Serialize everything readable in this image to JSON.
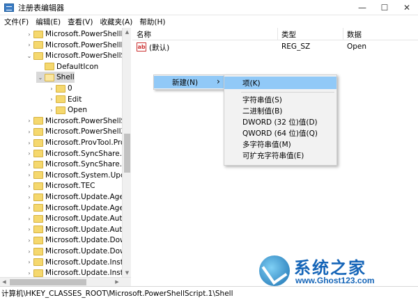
{
  "window": {
    "title": "注册表编辑器",
    "minimize": "—",
    "maximize": "☐",
    "close": "✕"
  },
  "menu": [
    "文件(F)",
    "编辑(E)",
    "查看(V)",
    "收藏夹(A)",
    "帮助(H)"
  ],
  "tree": [
    {
      "label": "Microsoft.PowerShellDa",
      "arrow": "›",
      "selected": false
    },
    {
      "label": "Microsoft.PowerShellMc",
      "arrow": "›",
      "selected": false
    },
    {
      "label": "Microsoft.PowerShellScr",
      "arrow": "⌄",
      "selected": false
    },
    {
      "label": "DefaultIcon",
      "arrow": "",
      "selected": false
    },
    {
      "label": "Shell",
      "arrow": "⌄",
      "selected": true
    },
    {
      "label": "0",
      "arrow": "›",
      "selected": false
    },
    {
      "label": "Edit",
      "arrow": "›",
      "selected": false
    },
    {
      "label": "Open",
      "arrow": "›",
      "selected": false
    },
    {
      "label": "Microsoft.PowerShellSes",
      "arrow": "›",
      "selected": false
    },
    {
      "label": "Microsoft.PowerShellXM",
      "arrow": "›",
      "selected": false
    },
    {
      "label": "Microsoft.ProvTool.Prov",
      "arrow": "›",
      "selected": false
    },
    {
      "label": "Microsoft.SyncShare.Syr",
      "arrow": "›",
      "selected": false
    },
    {
      "label": "Microsoft.SyncShare.Syr",
      "arrow": "›",
      "selected": false
    },
    {
      "label": "Microsoft.System.Updat",
      "arrow": "›",
      "selected": false
    },
    {
      "label": "Microsoft.TEC",
      "arrow": "›",
      "selected": false
    },
    {
      "label": "Microsoft.Update.Agent",
      "arrow": "›",
      "selected": false
    },
    {
      "label": "Microsoft.Update.Agent",
      "arrow": "›",
      "selected": false
    },
    {
      "label": "Microsoft.Update.AutoU",
      "arrow": "›",
      "selected": false
    },
    {
      "label": "Microsoft.Update.AutoU",
      "arrow": "›",
      "selected": false
    },
    {
      "label": "Microsoft.Update.Down",
      "arrow": "›",
      "selected": false
    },
    {
      "label": "Microsoft.Update.Down",
      "arrow": "›",
      "selected": false
    },
    {
      "label": "Microsoft.Update.Install",
      "arrow": "›",
      "selected": false
    },
    {
      "label": "Microsoft.Update.Install",
      "arrow": "›",
      "selected": false
    }
  ],
  "list": {
    "columns": [
      "名称",
      "类型",
      "数据"
    ],
    "rows": [
      {
        "icon_text": "ab",
        "name": "(默认)",
        "type": "REG_SZ",
        "data": "Open"
      }
    ]
  },
  "context_menu": {
    "new_label": "新建(N)",
    "submenu_arrow": "›",
    "submenu": [
      "项(K)",
      "字符串值(S)",
      "二进制值(B)",
      "DWORD (32 位)值(D)",
      "QWORD (64 位)值(Q)",
      "多字符串值(M)",
      "可扩充字符串值(E)"
    ]
  },
  "status": "计算机\\HKEY_CLASSES_ROOT\\Microsoft.PowerShellScript.1\\Shell",
  "watermark": {
    "cn": "系统之家",
    "en": "www.Ghost123.com"
  },
  "icons": {
    "app": "registry-editor-icon",
    "folder": "folder-icon",
    "string_value": "string-value-icon"
  }
}
